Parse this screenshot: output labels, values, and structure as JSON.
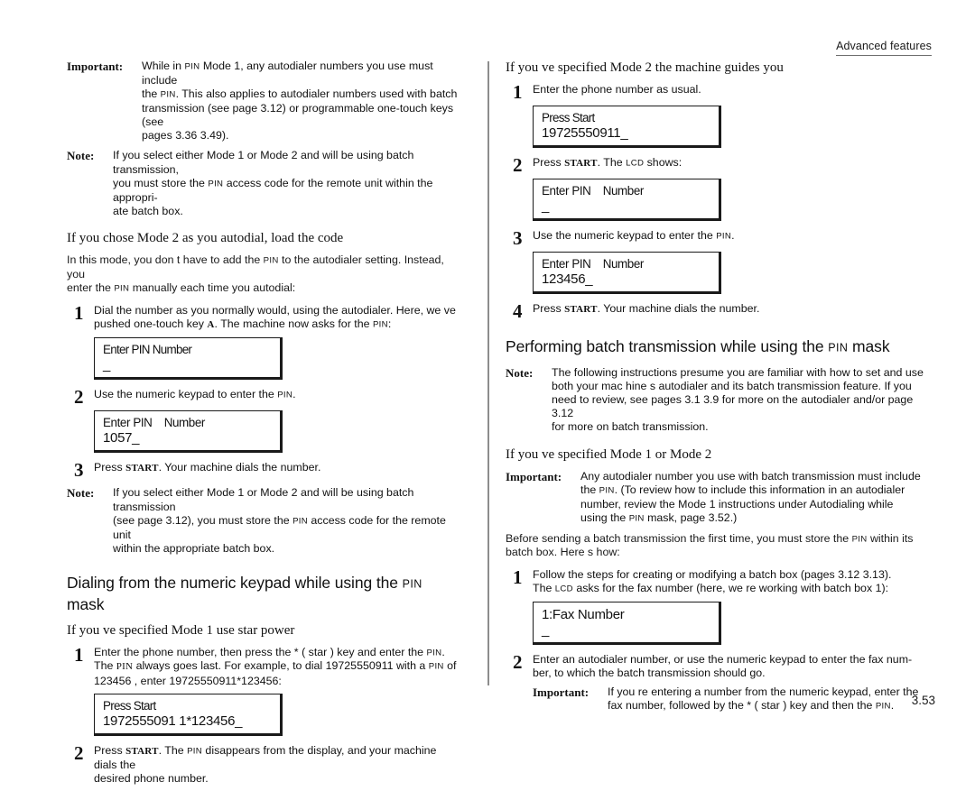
{
  "running_head": "Advanced features",
  "page_number": "3.53",
  "acronyms": {
    "pin": "PIN",
    "lcd": "LCD",
    "start": "START"
  },
  "left_column": {
    "important_1": {
      "label": "Important:",
      "line1_a": "While in ",
      "line1_b": " Mode 1, any autodialer numbers you use must include",
      "line2_a": "the ",
      "line2_b": ". This also applies to autodialer numbers used with batch",
      "line3": "transmission (see page 3.12) or programmable one-touch keys (see",
      "line4": "pages 3.36 3.49)."
    },
    "note_1": {
      "label": "Note:",
      "line1": "If you select either Mode 1 or Mode 2 and will be using batch transmission,",
      "line2_a": "you must store the ",
      "line2_b": " access code for the remote unit within the appropri-",
      "line3": "ate batch box."
    },
    "subheading_1": "If you chose Mode 2  as you autodial, load the code",
    "para_1": {
      "line1_a": "In this mode, you  don t have to add the ",
      "line1_b": " to the autodialer setting. Instead, you",
      "line2_a": "enter the ",
      "line2_b": " manually each time you autodial:"
    },
    "step_1": {
      "num": "1",
      "line1": "Dial the number as you normally would, using the autodialer. Here, we ve",
      "line2_a": "pushed one-touch key ",
      "line2_b": "A",
      "line2_c": ". The machine now asks for the ",
      "line2_d": ":"
    },
    "lcd_1": {
      "line1": "Enter PIN Number",
      "line2": "_"
    },
    "step_2": {
      "num": "2",
      "text_a": "Use the numeric keypad to enter the ",
      "text_b": "."
    },
    "lcd_2": {
      "line1": "Enter PIN    Number",
      "line2": "1057_"
    },
    "step_3": {
      "num": "3",
      "text_a": "Press ",
      "text_b": "START",
      "text_c": ". Your machine dials the number."
    },
    "note_2": {
      "label": "Note:",
      "line1": "If you select either Mode 1 or Mode 2 and will be using batch transmission",
      "line2_a": "(see page 3.12), you must store the ",
      "line2_b": " access code for the remote unit",
      "line3": "within the appropriate batch box."
    },
    "section_heading": {
      "a": "Dialing from the numeric keypad while using the  ",
      "b": " mask"
    },
    "subheading_2": "If you ve specified Mode 1  use  star power",
    "step_4": {
      "num": "1",
      "line1_a": "Enter the phone number, then press the  * ( star ) key and enter the ",
      "line1_b": ".",
      "line2_a": "The ",
      "line2_b": " always goes last. For example, to dial  19725550911 with a ",
      "line2_c": " of",
      "line3": " 123456 , enter  19725550911*123456:"
    },
    "lcd_3": {
      "line1": "Press Start",
      "line2": "1972555091 1*123456_"
    },
    "step_5": {
      "num": "2",
      "line1_a": "Press ",
      "line1_b": "START",
      "line1_c": ". The ",
      "line1_d": " disappears from the display, and your machine dials the",
      "line2": "desired phone number."
    }
  },
  "right_column": {
    "subheading_1": "If you ve specified Mode 2  the machine guides you",
    "step_1": {
      "num": "1",
      "text": "Enter the phone number as usual."
    },
    "lcd_1": {
      "line1": "Press Start",
      "line2": "19725550911_"
    },
    "step_2": {
      "num": "2",
      "text_a": "Press ",
      "text_b": "START",
      "text_c": ". The ",
      "text_d": " shows:"
    },
    "lcd_2": {
      "line1": "Enter PIN    Number",
      "line2": "_"
    },
    "step_3": {
      "num": "3",
      "text_a": "Use the numeric keypad to enter the ",
      "text_b": "."
    },
    "lcd_3": {
      "line1": "Enter PIN    Number",
      "line2": "123456_"
    },
    "step_4": {
      "num": "4",
      "text_a": "Press ",
      "text_b": "START",
      "text_c": ". Your machine dials the number."
    },
    "section_heading": {
      "a": "Performing batch transmission while using the  ",
      "b": " mask"
    },
    "note_1": {
      "label": "Note:",
      "line1": "The following instructions presume you are familiar with how to set and use",
      "line2": "both your mac hine s autodialer and its batch transmission feature. If you",
      "line3": "need to review, see pages 3.1 3.9 for more on the autodialer and/or page 3.12",
      "line4": "for more on batch transmission."
    },
    "subheading_2": "If you ve specified Mode 1 or Mode 2",
    "important_1": {
      "label": "Important:",
      "line1": "Any autodialer number you use with batch transmission   must include",
      "line2_a": "the ",
      "line2_b": ". (To review how to include this information in an autodialer",
      "line3": "number, review the Mode 1 instructions under  Autodialing while",
      "line4_a": "using the ",
      "line4_b": " mask,  page 3.52.)"
    },
    "para_1": {
      "line1_a": "Before sending a batch transmission the first time, you must store the ",
      "line1_b": " within its",
      "line2": "batch box. Here s how:"
    },
    "step_5": {
      "num": "1",
      "line1": "Follow the steps for creating or modifying a batch    box (pages 3.12 3.13).",
      "line2_a": "The ",
      "line2_b": " asks for the fax number (here, we re working with batch box 1):"
    },
    "lcd_4": {
      "line1": "1:Fax Number",
      "line2": "_"
    },
    "step_6": {
      "num": "2",
      "line1": "Enter an autodialer number, or use the numeric keypad to enter the fax num-",
      "line2": "ber, to which the batch transmission should go."
    },
    "important_2": {
      "label": "Important:",
      "line1": "If you re entering a number from the numeric keypad, enter the",
      "line2_a": "fax number, followed by the  * ( star ) key and then the ",
      "line2_b": "."
    }
  }
}
